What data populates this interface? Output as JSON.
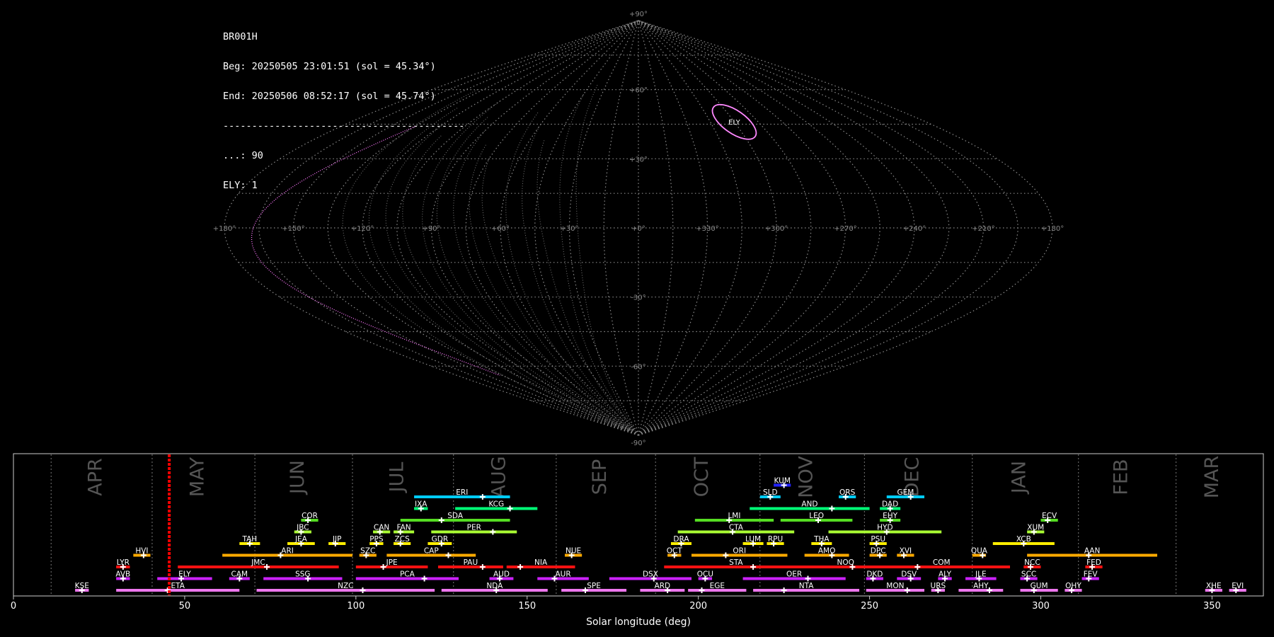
{
  "info": {
    "station": "BR001H",
    "begin": "Beg: 20250505 23:01:51 (sol = 45.34°)",
    "end": "End: 20250506 08:52:17 (sol = 45.74°)",
    "separator": "------------------------------------------",
    "sporadic": "...: 90",
    "shower": "ELY: 1"
  },
  "sky_map": {
    "projection": "sinusoidal",
    "grid_color": "#8a8a8a",
    "track_color": "#ff77ff",
    "lat_labels": [
      "+90°",
      "+60°",
      "+30°",
      "-30°",
      "-60°",
      "-90°"
    ],
    "lon_labels": [
      "+180°",
      "+150°",
      "+120°",
      "+90°",
      "+60°",
      "+30°",
      "+0°",
      "+330°",
      "+300°",
      "+270°",
      "+240°",
      "+210°",
      "+180°"
    ],
    "radiant": {
      "code": "ELY",
      "lon_display": 300,
      "lat": 46,
      "color": "#ff88ff"
    }
  },
  "chart_data": {
    "type": "timeline",
    "xlabel": "Solar longitude (deg)",
    "xlim": [
      0,
      365
    ],
    "xticks": [
      0,
      50,
      100,
      150,
      200,
      250,
      300,
      350
    ],
    "current_sol": 45.5,
    "months": [
      {
        "name": "APR",
        "start": 11,
        "end": 40.5
      },
      {
        "name": "MAY",
        "start": 40.5,
        "end": 70.5
      },
      {
        "name": "JUN",
        "start": 70.5,
        "end": 99
      },
      {
        "name": "JUL",
        "start": 99,
        "end": 128.5
      },
      {
        "name": "AUG",
        "start": 128.5,
        "end": 158.5
      },
      {
        "name": "SEP",
        "start": 158.5,
        "end": 187.5
      },
      {
        "name": "OCT",
        "start": 187.5,
        "end": 218
      },
      {
        "name": "NOV",
        "start": 218,
        "end": 248.5
      },
      {
        "name": "DEC",
        "start": 248.5,
        "end": 280
      },
      {
        "name": "JAN",
        "start": 280,
        "end": 311
      },
      {
        "name": "FEB",
        "start": 311,
        "end": 339.5
      },
      {
        "name": "MAR",
        "start": 339.5,
        "end": 369
      }
    ],
    "showers": [
      {
        "code": "KUM",
        "row": 9,
        "start": 222,
        "end": 227,
        "peak": 225,
        "color": "#2222ff"
      },
      {
        "code": "ERI",
        "row": 8,
        "start": 117,
        "end": 145,
        "peak": 137,
        "color": "#00ccff"
      },
      {
        "code": "SLD",
        "row": 8,
        "start": 218,
        "end": 224,
        "peak": 221,
        "color": "#00ccff"
      },
      {
        "code": "ORS",
        "row": 8,
        "start": 241,
        "end": 246,
        "peak": 243,
        "color": "#00ccff"
      },
      {
        "code": "GEM",
        "row": 8,
        "start": 255,
        "end": 266,
        "peak": 262,
        "color": "#00ccff"
      },
      {
        "code": "IXA",
        "row": 7,
        "start": 117,
        "end": 121,
        "peak": 119,
        "color": "#00ff77"
      },
      {
        "code": "KCG",
        "row": 7,
        "start": 129,
        "end": 153,
        "peak": 145,
        "color": "#00ff77"
      },
      {
        "code": "AND",
        "row": 7,
        "start": 215,
        "end": 250,
        "peak": 239,
        "color": "#00ff77"
      },
      {
        "code": "DAD",
        "row": 7,
        "start": 253,
        "end": 259,
        "peak": 256,
        "color": "#00ff77"
      },
      {
        "code": "COR",
        "row": 6,
        "start": 84,
        "end": 89,
        "peak": 86,
        "color": "#55dd22"
      },
      {
        "code": "SDA",
        "row": 6,
        "start": 113,
        "end": 145,
        "peak": 125,
        "color": "#55dd22"
      },
      {
        "code": "LMI",
        "row": 6,
        "start": 199,
        "end": 222,
        "peak": 209,
        "color": "#55dd22"
      },
      {
        "code": "LEO",
        "row": 6,
        "start": 224,
        "end": 245,
        "peak": 235,
        "color": "#55dd22"
      },
      {
        "code": "EHY",
        "row": 6,
        "start": 253,
        "end": 259,
        "peak": 256,
        "color": "#55dd22"
      },
      {
        "code": "ECV",
        "row": 6,
        "start": 300,
        "end": 305,
        "peak": 302,
        "color": "#55dd22"
      },
      {
        "code": "JBC",
        "row": 5,
        "start": 82,
        "end": 87,
        "peak": 84,
        "color": "#aaff33"
      },
      {
        "code": "CAN",
        "row": 5,
        "start": 105,
        "end": 110,
        "peak": 107,
        "color": "#aaff33"
      },
      {
        "code": "FAN",
        "row": 5,
        "start": 111,
        "end": 117,
        "peak": 113,
        "color": "#aaff33"
      },
      {
        "code": "PER",
        "row": 5,
        "start": 122,
        "end": 147,
        "peak": 140,
        "color": "#aaff33"
      },
      {
        "code": "CTA",
        "row": 5,
        "start": 194,
        "end": 228,
        "peak": 210,
        "color": "#aaff33"
      },
      {
        "code": "HYD",
        "row": 5,
        "start": 238,
        "end": 271,
        "peak": 255,
        "color": "#aaff33"
      },
      {
        "code": "XUM",
        "row": 5,
        "start": 296,
        "end": 301,
        "peak": 298,
        "color": "#aaff33"
      },
      {
        "code": "TAH",
        "row": 4,
        "start": 66,
        "end": 72,
        "peak": 69,
        "color": "#ffee00"
      },
      {
        "code": "JEA",
        "row": 4,
        "start": 80,
        "end": 88,
        "peak": 84,
        "color": "#ffee00"
      },
      {
        "code": "JIP",
        "row": 4,
        "start": 92,
        "end": 97,
        "peak": 94,
        "color": "#ffee00"
      },
      {
        "code": "PPS",
        "row": 4,
        "start": 104,
        "end": 108,
        "peak": 106,
        "color": "#ffee00"
      },
      {
        "code": "ZCS",
        "row": 4,
        "start": 111,
        "end": 116,
        "peak": 113,
        "color": "#ffee00"
      },
      {
        "code": "GDR",
        "row": 4,
        "start": 121,
        "end": 128,
        "peak": 125,
        "color": "#ffee00"
      },
      {
        "code": "DRA",
        "row": 4,
        "start": 192,
        "end": 198,
        "peak": 195,
        "color": "#ffee00"
      },
      {
        "code": "LUM",
        "row": 4,
        "start": 213,
        "end": 219,
        "peak": 216,
        "color": "#ffee00"
      },
      {
        "code": "RPU",
        "row": 4,
        "start": 220,
        "end": 225,
        "peak": 222,
        "color": "#ffee00"
      },
      {
        "code": "THA",
        "row": 4,
        "start": 233,
        "end": 239,
        "peak": 236,
        "color": "#ffee00"
      },
      {
        "code": "PSU",
        "row": 4,
        "start": 250,
        "end": 255,
        "peak": 252,
        "color": "#ffee00"
      },
      {
        "code": "XCB",
        "row": 4,
        "start": 286,
        "end": 304,
        "peak": 295,
        "color": "#ffee00"
      },
      {
        "code": "HVI",
        "row": 3,
        "start": 35,
        "end": 40,
        "peak": 38,
        "color": "#ffaa00"
      },
      {
        "code": "ARI",
        "row": 3,
        "start": 61,
        "end": 99,
        "peak": 78,
        "color": "#ffaa00"
      },
      {
        "code": "SZC",
        "row": 3,
        "start": 101,
        "end": 106,
        "peak": 103,
        "color": "#ffaa00"
      },
      {
        "code": "CAP",
        "row": 3,
        "start": 109,
        "end": 135,
        "peak": 127,
        "color": "#ffaa00"
      },
      {
        "code": "NUE",
        "row": 3,
        "start": 161,
        "end": 166,
        "peak": 163,
        "color": "#ffaa00"
      },
      {
        "code": "OCT",
        "row": 3,
        "start": 191,
        "end": 195,
        "peak": 193,
        "color": "#ffaa00"
      },
      {
        "code": "ORI",
        "row": 3,
        "start": 198,
        "end": 226,
        "peak": 208,
        "color": "#ffaa00"
      },
      {
        "code": "AMO",
        "row": 3,
        "start": 231,
        "end": 244,
        "peak": 239,
        "color": "#ffaa00"
      },
      {
        "code": "DPC",
        "row": 3,
        "start": 250,
        "end": 255,
        "peak": 253,
        "color": "#ffaa00"
      },
      {
        "code": "XVI",
        "row": 3,
        "start": 258,
        "end": 263,
        "peak": 260,
        "color": "#ffaa00"
      },
      {
        "code": "QUA",
        "row": 3,
        "start": 280,
        "end": 284,
        "peak": 283,
        "color": "#ffaa00"
      },
      {
        "code": "AAN",
        "row": 3,
        "start": 296,
        "end": 334,
        "peak": 314,
        "color": "#ffaa00"
      },
      {
        "code": "LYR",
        "row": 2,
        "start": 30,
        "end": 34,
        "peak": 32,
        "color": "#ff1111"
      },
      {
        "code": "JMC",
        "row": 2,
        "start": 48,
        "end": 95,
        "peak": 74,
        "color": "#ff1111"
      },
      {
        "code": "JPE",
        "row": 2,
        "start": 100,
        "end": 121,
        "peak": 108,
        "color": "#ff1111"
      },
      {
        "code": "PAU",
        "row": 2,
        "start": 124,
        "end": 143,
        "peak": 137,
        "color": "#ff1111"
      },
      {
        "code": "NIA",
        "row": 2,
        "start": 144,
        "end": 164,
        "peak": 148,
        "color": "#ff1111"
      },
      {
        "code": "STA",
        "row": 2,
        "start": 190,
        "end": 232,
        "peak": 216,
        "color": "#ff1111"
      },
      {
        "code": "NOO",
        "row": 2,
        "start": 232,
        "end": 254,
        "peak": 245,
        "color": "#ff1111"
      },
      {
        "code": "COM",
        "row": 2,
        "start": 251,
        "end": 291,
        "peak": 264,
        "color": "#ff1111"
      },
      {
        "code": "NCC",
        "row": 2,
        "start": 295,
        "end": 300,
        "peak": 297,
        "color": "#ff1111"
      },
      {
        "code": "FED",
        "row": 2,
        "start": 313,
        "end": 318,
        "peak": 315,
        "color": "#ff1111"
      },
      {
        "code": "AVB",
        "row": 1,
        "start": 30,
        "end": 34,
        "peak": 32,
        "color": "#cc22ff"
      },
      {
        "code": "ELY",
        "row": 1,
        "start": 42,
        "end": 58,
        "peak": 49,
        "color": "#cc22ff"
      },
      {
        "code": "CAM",
        "row": 1,
        "start": 63,
        "end": 69,
        "peak": 66,
        "color": "#cc22ff"
      },
      {
        "code": "SSG",
        "row": 1,
        "start": 73,
        "end": 96,
        "peak": 86,
        "color": "#cc22ff"
      },
      {
        "code": "PCA",
        "row": 1,
        "start": 100,
        "end": 130,
        "peak": 120,
        "color": "#cc22ff"
      },
      {
        "code": "AUD",
        "row": 1,
        "start": 139,
        "end": 146,
        "peak": 142,
        "color": "#cc22ff"
      },
      {
        "code": "AUR",
        "row": 1,
        "start": 153,
        "end": 168,
        "peak": 158,
        "color": "#cc22ff"
      },
      {
        "code": "DSX",
        "row": 1,
        "start": 174,
        "end": 198,
        "peak": 187,
        "color": "#cc22ff"
      },
      {
        "code": "OCU",
        "row": 1,
        "start": 200,
        "end": 204,
        "peak": 202,
        "color": "#cc22ff"
      },
      {
        "code": "OER",
        "row": 1,
        "start": 213,
        "end": 243,
        "peak": 232,
        "color": "#cc22ff"
      },
      {
        "code": "DKD",
        "row": 1,
        "start": 249,
        "end": 254,
        "peak": 251,
        "color": "#cc22ff"
      },
      {
        "code": "DSV",
        "row": 1,
        "start": 258,
        "end": 265,
        "peak": 262,
        "color": "#cc22ff"
      },
      {
        "code": "ALY",
        "row": 1,
        "start": 270,
        "end": 274,
        "peak": 272,
        "color": "#cc22ff"
      },
      {
        "code": "JLE",
        "row": 1,
        "start": 278,
        "end": 287,
        "peak": 282,
        "color": "#cc22ff"
      },
      {
        "code": "SCC",
        "row": 1,
        "start": 294,
        "end": 299,
        "peak": 296,
        "color": "#cc22ff"
      },
      {
        "code": "FEV",
        "row": 1,
        "start": 312,
        "end": 317,
        "peak": 314,
        "color": "#cc22ff"
      },
      {
        "code": "KSE",
        "row": 0,
        "start": 18,
        "end": 22,
        "peak": 20,
        "color": "#ee77ee"
      },
      {
        "code": "ETA",
        "row": 0,
        "start": 30,
        "end": 66,
        "peak": 45,
        "color": "#ee77ee"
      },
      {
        "code": "NZC",
        "row": 0,
        "start": 71,
        "end": 123,
        "peak": 102,
        "color": "#ee77ee"
      },
      {
        "code": "NDA",
        "row": 0,
        "start": 125,
        "end": 156,
        "peak": 141,
        "color": "#ee77ee"
      },
      {
        "code": "SPE",
        "row": 0,
        "start": 160,
        "end": 179,
        "peak": 167,
        "color": "#ee77ee"
      },
      {
        "code": "ARD",
        "row": 0,
        "start": 183,
        "end": 196,
        "peak": 191,
        "color": "#ee77ee"
      },
      {
        "code": "EGE",
        "row": 0,
        "start": 197,
        "end": 214,
        "peak": 201,
        "color": "#ee77ee"
      },
      {
        "code": "NTA",
        "row": 0,
        "start": 216,
        "end": 247,
        "peak": 225,
        "color": "#ee77ee"
      },
      {
        "code": "MON",
        "row": 0,
        "start": 249,
        "end": 266,
        "peak": 261,
        "color": "#ee77ee"
      },
      {
        "code": "URS",
        "row": 0,
        "start": 268,
        "end": 272,
        "peak": 270,
        "color": "#ee77ee"
      },
      {
        "code": "AHY",
        "row": 0,
        "start": 276,
        "end": 289,
        "peak": 285,
        "color": "#ee77ee"
      },
      {
        "code": "GUM",
        "row": 0,
        "start": 294,
        "end": 305,
        "peak": 298,
        "color": "#ee77ee"
      },
      {
        "code": "OHY",
        "row": 0,
        "start": 307,
        "end": 312,
        "peak": 309,
        "color": "#ee77ee"
      },
      {
        "code": "XHE",
        "row": 0,
        "start": 348,
        "end": 353,
        "peak": 350,
        "color": "#ee77ee"
      },
      {
        "code": "EVI",
        "row": 0,
        "start": 355,
        "end": 360,
        "peak": 357,
        "color": "#ee77ee"
      }
    ]
  }
}
